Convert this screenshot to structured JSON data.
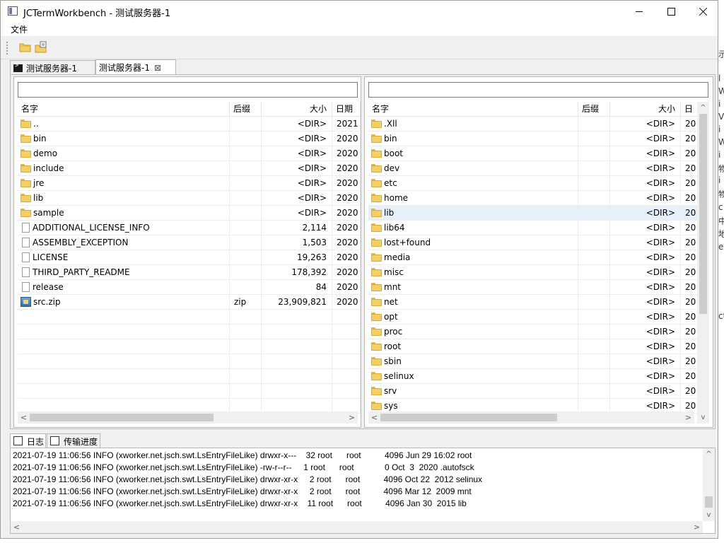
{
  "window": {
    "title": "JCTermWorkbench - 测试服务器-1"
  },
  "menu": {
    "file": "文件"
  },
  "tabs": [
    {
      "label": "测试服务器-1"
    },
    {
      "label": "测试服务器-1",
      "close": "⊠"
    }
  ],
  "left_pane": {
    "path": "",
    "headers": {
      "name": "名字",
      "ext": "后缀",
      "size": "大小",
      "date": "日期"
    },
    "rows": [
      {
        "type": "dir",
        "name": "..",
        "ext": "",
        "size": "<DIR>",
        "date": "2021"
      },
      {
        "type": "dir",
        "name": "bin",
        "ext": "",
        "size": "<DIR>",
        "date": "2020"
      },
      {
        "type": "dir",
        "name": "demo",
        "ext": "",
        "size": "<DIR>",
        "date": "2020"
      },
      {
        "type": "dir",
        "name": "include",
        "ext": "",
        "size": "<DIR>",
        "date": "2020"
      },
      {
        "type": "dir",
        "name": "jre",
        "ext": "",
        "size": "<DIR>",
        "date": "2020"
      },
      {
        "type": "dir",
        "name": "lib",
        "ext": "",
        "size": "<DIR>",
        "date": "2020"
      },
      {
        "type": "dir",
        "name": "sample",
        "ext": "",
        "size": "<DIR>",
        "date": "2020"
      },
      {
        "type": "file",
        "name": "ADDITIONAL_LICENSE_INFO",
        "ext": "",
        "size": "2,114",
        "date": "2020"
      },
      {
        "type": "file",
        "name": "ASSEMBLY_EXCEPTION",
        "ext": "",
        "size": "1,503",
        "date": "2020"
      },
      {
        "type": "file",
        "name": "LICENSE",
        "ext": "",
        "size": "19,263",
        "date": "2020"
      },
      {
        "type": "file",
        "name": "THIRD_PARTY_README",
        "ext": "",
        "size": "178,392",
        "date": "2020"
      },
      {
        "type": "file",
        "name": "release",
        "ext": "",
        "size": "84",
        "date": "2020"
      },
      {
        "type": "zip",
        "name": "src.zip",
        "ext": "zip",
        "size": "23,909,821",
        "date": "2020"
      }
    ]
  },
  "right_pane": {
    "path": "",
    "headers": {
      "name": "名字",
      "ext": "后缀",
      "size": "大小",
      "date": "日"
    },
    "rows": [
      {
        "name": ".Xll",
        "size": "<DIR>",
        "date": "20"
      },
      {
        "name": "bin",
        "size": "<DIR>",
        "date": "20"
      },
      {
        "name": "boot",
        "size": "<DIR>",
        "date": "20"
      },
      {
        "name": "dev",
        "size": "<DIR>",
        "date": "20"
      },
      {
        "name": "etc",
        "size": "<DIR>",
        "date": "20"
      },
      {
        "name": "home",
        "size": "<DIR>",
        "date": "20"
      },
      {
        "name": "lib",
        "size": "<DIR>",
        "date": "20",
        "selected": true
      },
      {
        "name": "lib64",
        "size": "<DIR>",
        "date": "20"
      },
      {
        "name": "lost+found",
        "size": "<DIR>",
        "date": "20"
      },
      {
        "name": "media",
        "size": "<DIR>",
        "date": "20"
      },
      {
        "name": "misc",
        "size": "<DIR>",
        "date": "20"
      },
      {
        "name": "mnt",
        "size": "<DIR>",
        "date": "20"
      },
      {
        "name": "net",
        "size": "<DIR>",
        "date": "20"
      },
      {
        "name": "opt",
        "size": "<DIR>",
        "date": "20"
      },
      {
        "name": "proc",
        "size": "<DIR>",
        "date": "20"
      },
      {
        "name": "root",
        "size": "<DIR>",
        "date": "20"
      },
      {
        "name": "sbin",
        "size": "<DIR>",
        "date": "20"
      },
      {
        "name": "selinux",
        "size": "<DIR>",
        "date": "20"
      },
      {
        "name": "srv",
        "size": "<DIR>",
        "date": "20"
      },
      {
        "name": "sys",
        "size": "<DIR>",
        "date": "20"
      }
    ]
  },
  "bottom_tabs": [
    {
      "label": "日志"
    },
    {
      "label": "传输进度"
    }
  ],
  "log_lines": [
    "2021-07-19 11:06:56 INFO (xworker.net.jsch.swt.LsEntryFileLike) drwxr-x---    32 root      root          4096 Jun 29 16:02 root",
    "2021-07-19 11:06:56 INFO (xworker.net.jsch.swt.LsEntryFileLike) -rw-r--r--     1 root      root             0 Oct  3  2020 .autofsck",
    "2021-07-19 11:06:56 INFO (xworker.net.jsch.swt.LsEntryFileLike) drwxr-xr-x     2 root      root          4096 Oct 22  2012 selinux",
    "2021-07-19 11:06:56 INFO (xworker.net.jsch.swt.LsEntryFileLike) drwxr-xr-x     2 root      root          4096 Mar 12  2009 mnt",
    "2021-07-19 11:06:56 INFO (xworker.net.jsch.swt.LsEntryFileLike) drwxr-xr-x    11 root      root          4096 Jan 30  2015 lib"
  ],
  "background_glyphs": [
    "示",
    "l",
    "W",
    "i",
    "V",
    "i",
    "W",
    "i",
    "物",
    "i",
    "物",
    "c",
    "中",
    "地",
    "e",
    "ct"
  ]
}
